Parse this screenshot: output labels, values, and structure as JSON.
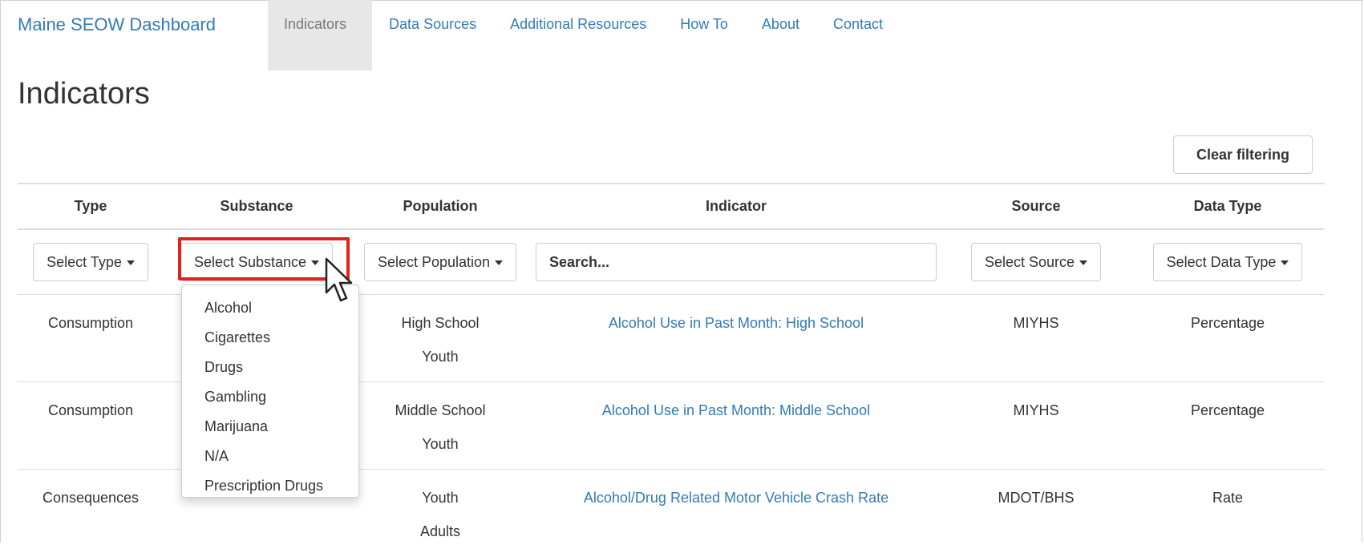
{
  "navbar": {
    "brand": "Maine SEOW Dashboard",
    "items": [
      {
        "label": "Indicators",
        "active": true
      },
      {
        "label": "Data Sources"
      },
      {
        "label": "Additional Resources"
      },
      {
        "label": "How To"
      },
      {
        "label": "About"
      },
      {
        "label": "Contact"
      }
    ]
  },
  "page": {
    "title": "Indicators",
    "clear_button": "Clear filtering"
  },
  "table": {
    "headers": [
      "Type",
      "Substance",
      "Population",
      "Indicator",
      "Source",
      "Data Type"
    ],
    "filters": {
      "type": "Select Type",
      "substance": "Select Substance",
      "population": "Select Population",
      "search_placeholder": "Search...",
      "source": "Select Source",
      "data_type": "Select Data Type"
    },
    "rows": [
      {
        "type": "Consumption",
        "population": [
          "High School",
          "Youth"
        ],
        "indicator": "Alcohol Use in Past Month: High School",
        "source": "MIYHS",
        "data_type": "Percentage"
      },
      {
        "type": "Consumption",
        "population": [
          "Middle School",
          "Youth"
        ],
        "indicator": "Alcohol Use in Past Month: Middle School",
        "source": "MIYHS",
        "data_type": "Percentage"
      },
      {
        "type": "Consequences",
        "population": [
          "Youth",
          "Adults"
        ],
        "indicator": "Alcohol/Drug Related Motor Vehicle Crash Rate",
        "source": "MDOT/BHS",
        "data_type": "Rate"
      }
    ]
  },
  "substance_menu": {
    "options": [
      "Alcohol",
      "Cigarettes",
      "Drugs",
      "Gambling",
      "Marijuana",
      "N/A",
      "Prescription Drugs"
    ]
  },
  "colors": {
    "link": "#337ab7",
    "highlight": "#e2231a",
    "active_nav_bg": "#e7e7e7"
  },
  "icons": [
    "caret-down-icon",
    "mouse-pointer-icon"
  ]
}
